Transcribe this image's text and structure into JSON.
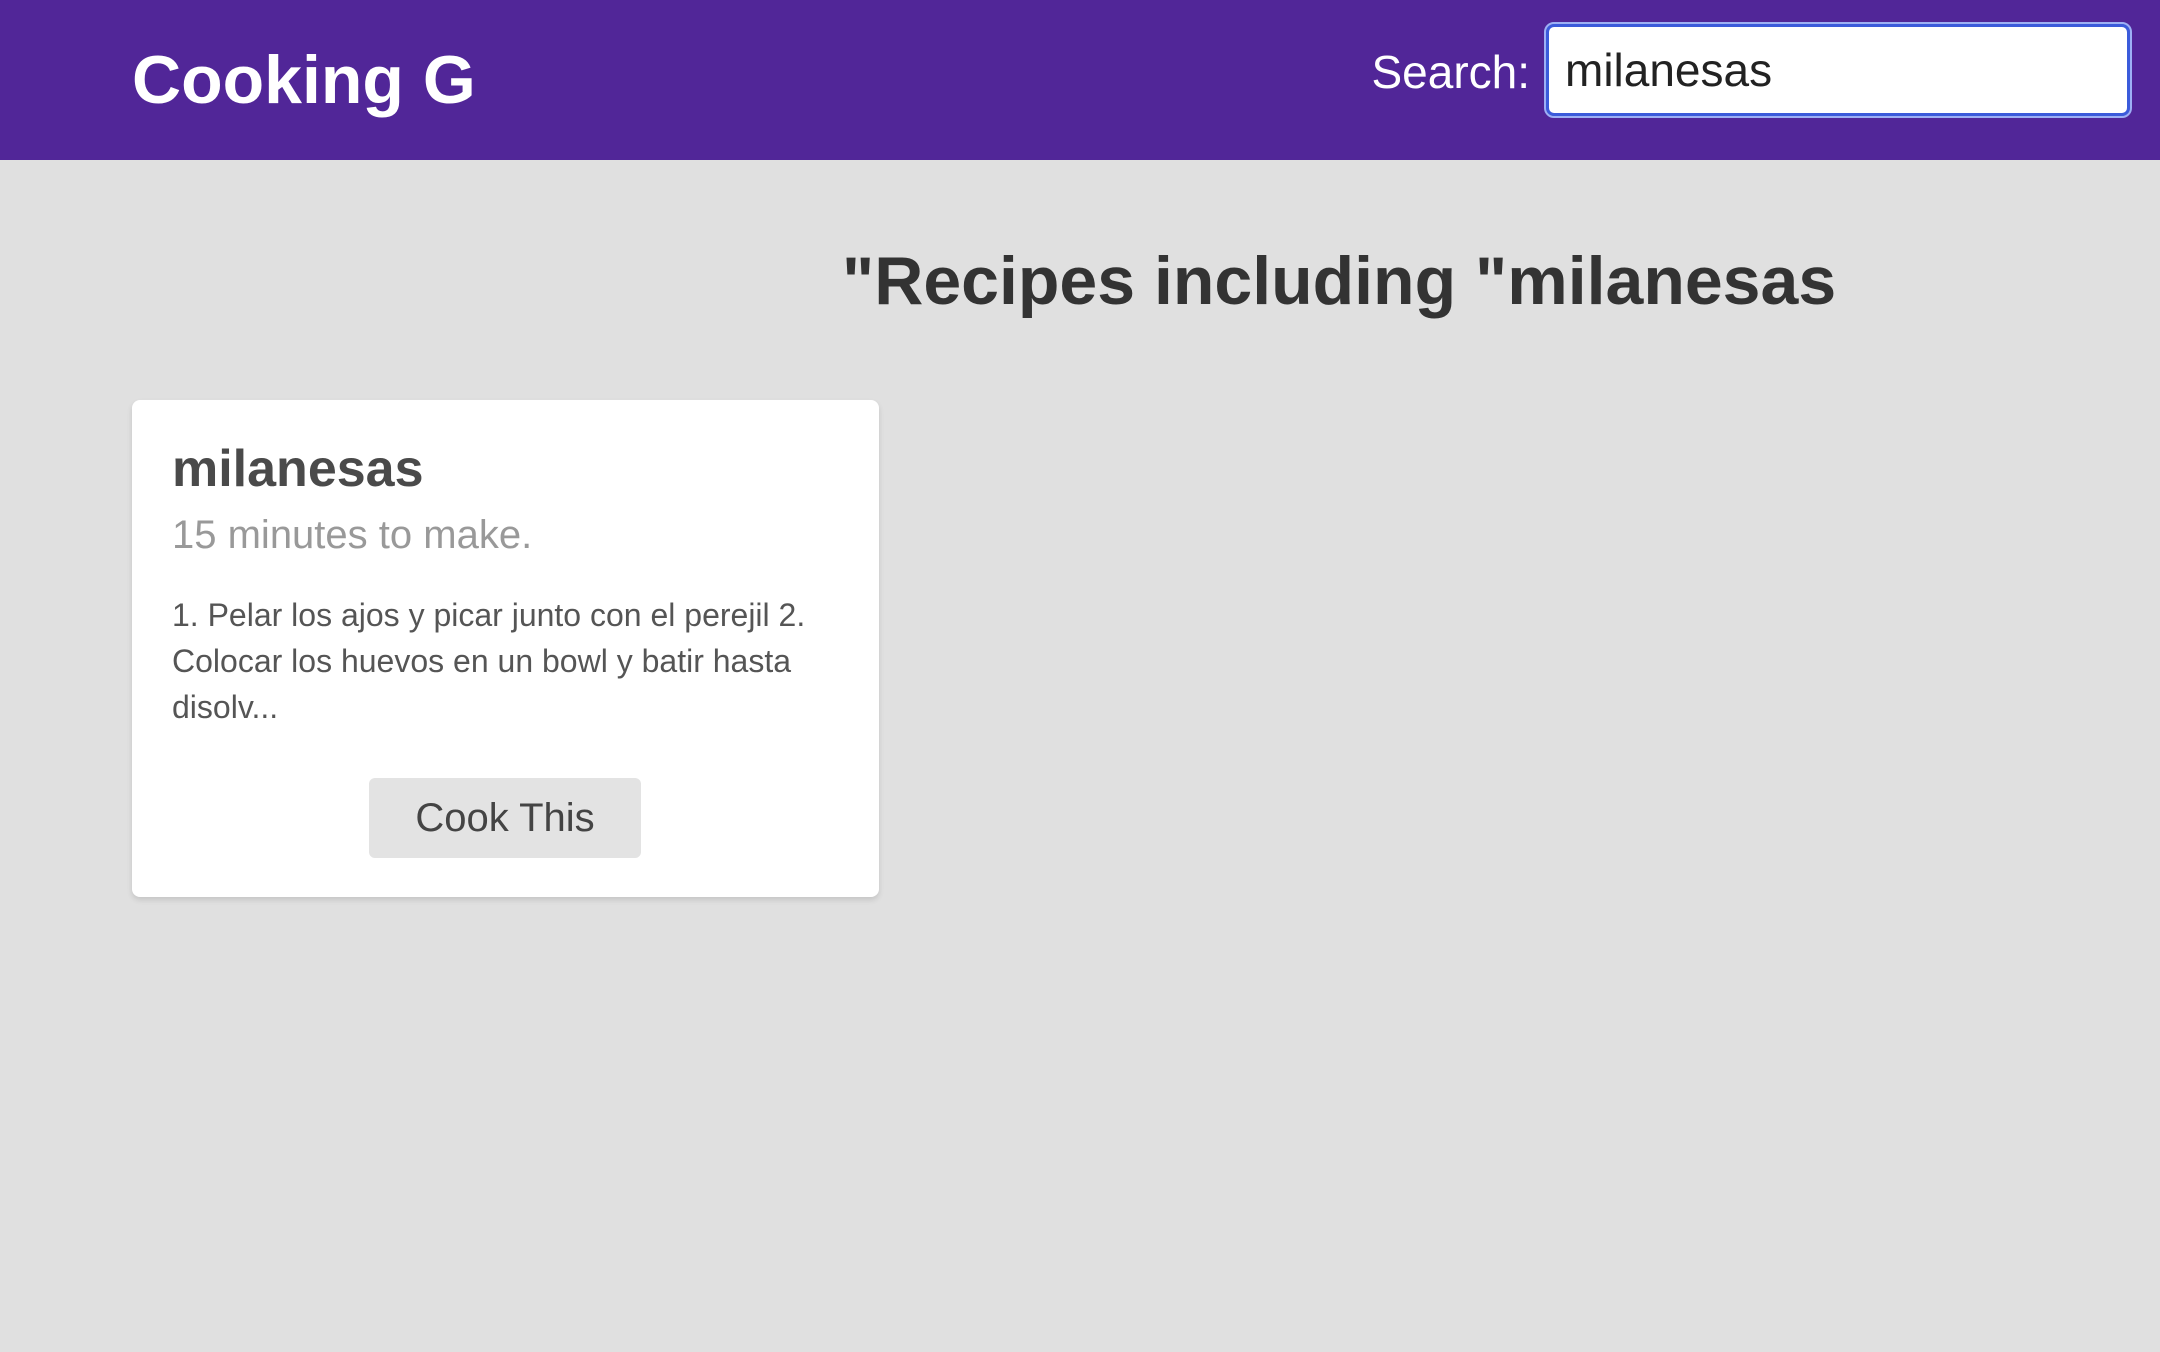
{
  "header": {
    "brand": "Cooking G",
    "search_label": "Search:",
    "search_value": "milanesas",
    "search_placeholder": ""
  },
  "main": {
    "heading": "\"Recipes including \"milanesas",
    "recipes": [
      {
        "title": "milanesas",
        "time": "15 minutes to make.",
        "description": "1. Pelar los ajos y picar junto con el perejil 2. Colocar los huevos en un bowl y batir hasta disolv...",
        "button_label": "Cook This"
      }
    ]
  },
  "colors": {
    "header_bg": "#512698",
    "page_bg": "#e0e0e0",
    "card_bg": "#ffffff",
    "button_bg": "#e3e3e3",
    "focus_border": "#3b5bdb"
  }
}
